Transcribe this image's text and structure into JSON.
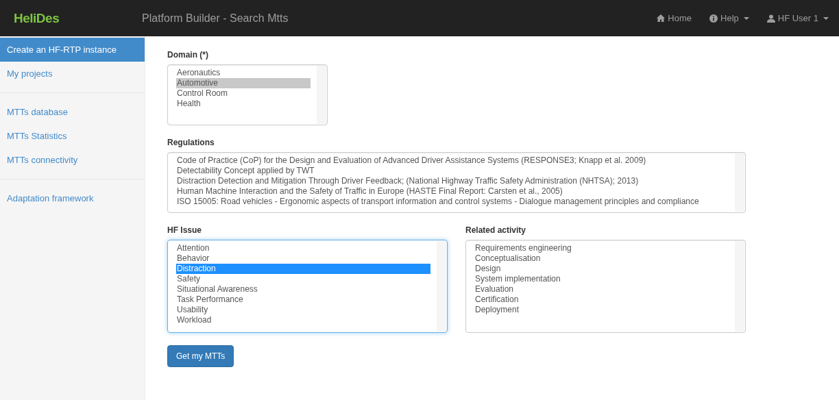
{
  "navbar": {
    "brand": "HeliDes",
    "title": "Platform Builder - Search Mtts",
    "links": [
      {
        "kind": "home",
        "label": "Home",
        "dropdown": false
      },
      {
        "kind": "info",
        "label": "Help",
        "dropdown": true
      },
      {
        "kind": "user",
        "label": "HF User 1",
        "dropdown": true
      }
    ]
  },
  "sidebar": {
    "groups": [
      {
        "items": [
          {
            "label": "Create an HF-RTP instance",
            "selected": true
          },
          {
            "label": "My projects",
            "selected": false
          }
        ]
      },
      {
        "items": [
          {
            "label": "MTTs database",
            "selected": false
          },
          {
            "label": "MTTs Statistics",
            "selected": false
          },
          {
            "label": "MTTs connectivity",
            "selected": false
          }
        ]
      },
      {
        "items": [
          {
            "label": "Adaptation framework",
            "selected": false
          }
        ]
      }
    ]
  },
  "form": {
    "fields": [
      {
        "label": "Domain (*)",
        "kind": "short",
        "focused": false,
        "options": [
          {
            "label": "Aeronautics",
            "selected": false
          },
          {
            "label": "Automotive",
            "selected": true
          },
          {
            "label": "Control Room",
            "selected": false
          },
          {
            "label": "Health",
            "selected": false
          }
        ]
      },
      {
        "label": "Regulations",
        "kind": "wide",
        "focused": false,
        "options": [
          {
            "label": "Code of Practice (CoP) for the Design and Evaluation of Advanced Driver Assistance Systems (RESPONSE3; Knapp et al. 2009)",
            "selected": false
          },
          {
            "label": "Detectability Concept applied by TWT",
            "selected": false
          },
          {
            "label": "Distraction Detection and Mitigation Through Driver Feedback; (National Highway Traffic Safety Administration (NHTSA); 2013)",
            "selected": false
          },
          {
            "label": "Human Machine Interaction and the Safety of Traffic in Europe (HASTE Final Report: Carsten et al., 2005)",
            "selected": false
          },
          {
            "label": "ISO 15005: Road vehicles - Ergonomic aspects of transport information and control systems - Dialogue management principles and compliance",
            "selected": false
          }
        ]
      },
      {
        "label": "HF Issue",
        "kind": "half",
        "focused": true,
        "options": [
          {
            "label": "Attention",
            "selected": false
          },
          {
            "label": "Behavior",
            "selected": false
          },
          {
            "label": "Distraction",
            "selected": true
          },
          {
            "label": "Safety",
            "selected": false
          },
          {
            "label": "Situational Awareness",
            "selected": false
          },
          {
            "label": "Task Performance",
            "selected": false
          },
          {
            "label": "Usability",
            "selected": false
          },
          {
            "label": "Workload",
            "selected": false
          }
        ]
      },
      {
        "label": "Related activity",
        "kind": "half",
        "focused": false,
        "options": [
          {
            "label": "Requirements engineering",
            "selected": false
          },
          {
            "label": "Conceptualisation",
            "selected": false
          },
          {
            "label": "Design",
            "selected": false
          },
          {
            "label": "System implementation",
            "selected": false
          },
          {
            "label": "Evaluation",
            "selected": false
          },
          {
            "label": "Certification",
            "selected": false
          },
          {
            "label": "Deployment",
            "selected": false
          }
        ]
      }
    ],
    "submit": "Get my MTTs"
  }
}
